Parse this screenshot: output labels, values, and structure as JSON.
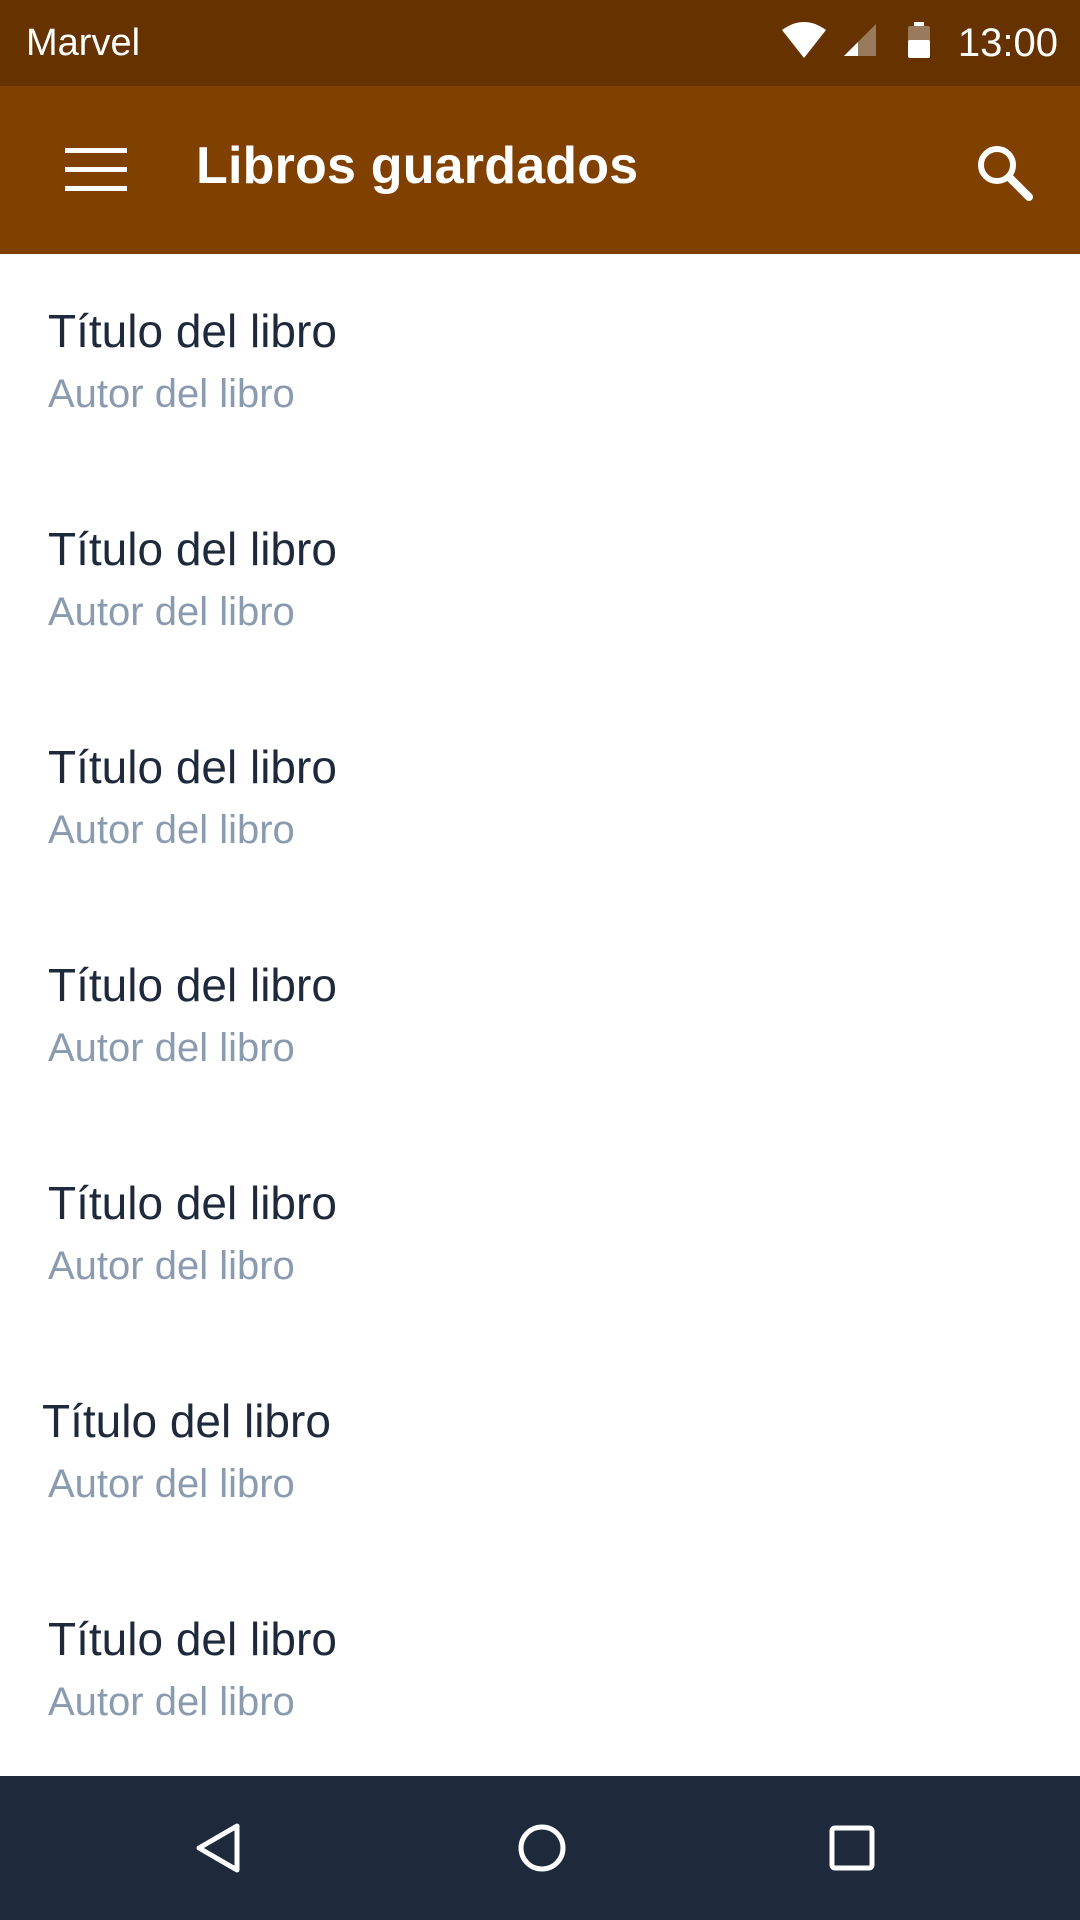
{
  "status_bar": {
    "carrier": "Marvel",
    "time": "13:00",
    "icons": [
      "wifi-icon",
      "cell-signal-icon",
      "battery-icon"
    ],
    "background": "#663300"
  },
  "app_bar": {
    "title": "Libros guardados",
    "menu_icon": "hamburger-menu-icon",
    "search_icon": "search-icon",
    "background": "#804000"
  },
  "books": [
    {
      "title": "Título del libro",
      "author": "Autor del libro"
    },
    {
      "title": "Título del libro",
      "author": "Autor del libro"
    },
    {
      "title": "Título del libro",
      "author": "Autor del libro"
    },
    {
      "title": "Título del libro",
      "author": "Autor del libro"
    },
    {
      "title": "Título del libro",
      "author": "Autor del libro"
    },
    {
      "title": "Título del libro",
      "author": "Autor del libro"
    },
    {
      "title": "Título del libro",
      "author": "Autor del libro"
    }
  ],
  "colors": {
    "title_text": "#1e2a3b",
    "author_text": "#8a9bb0",
    "nav_background": "#1e2a3b"
  },
  "nav_bar": {
    "buttons": [
      "back-icon",
      "home-icon",
      "recents-icon"
    ]
  }
}
